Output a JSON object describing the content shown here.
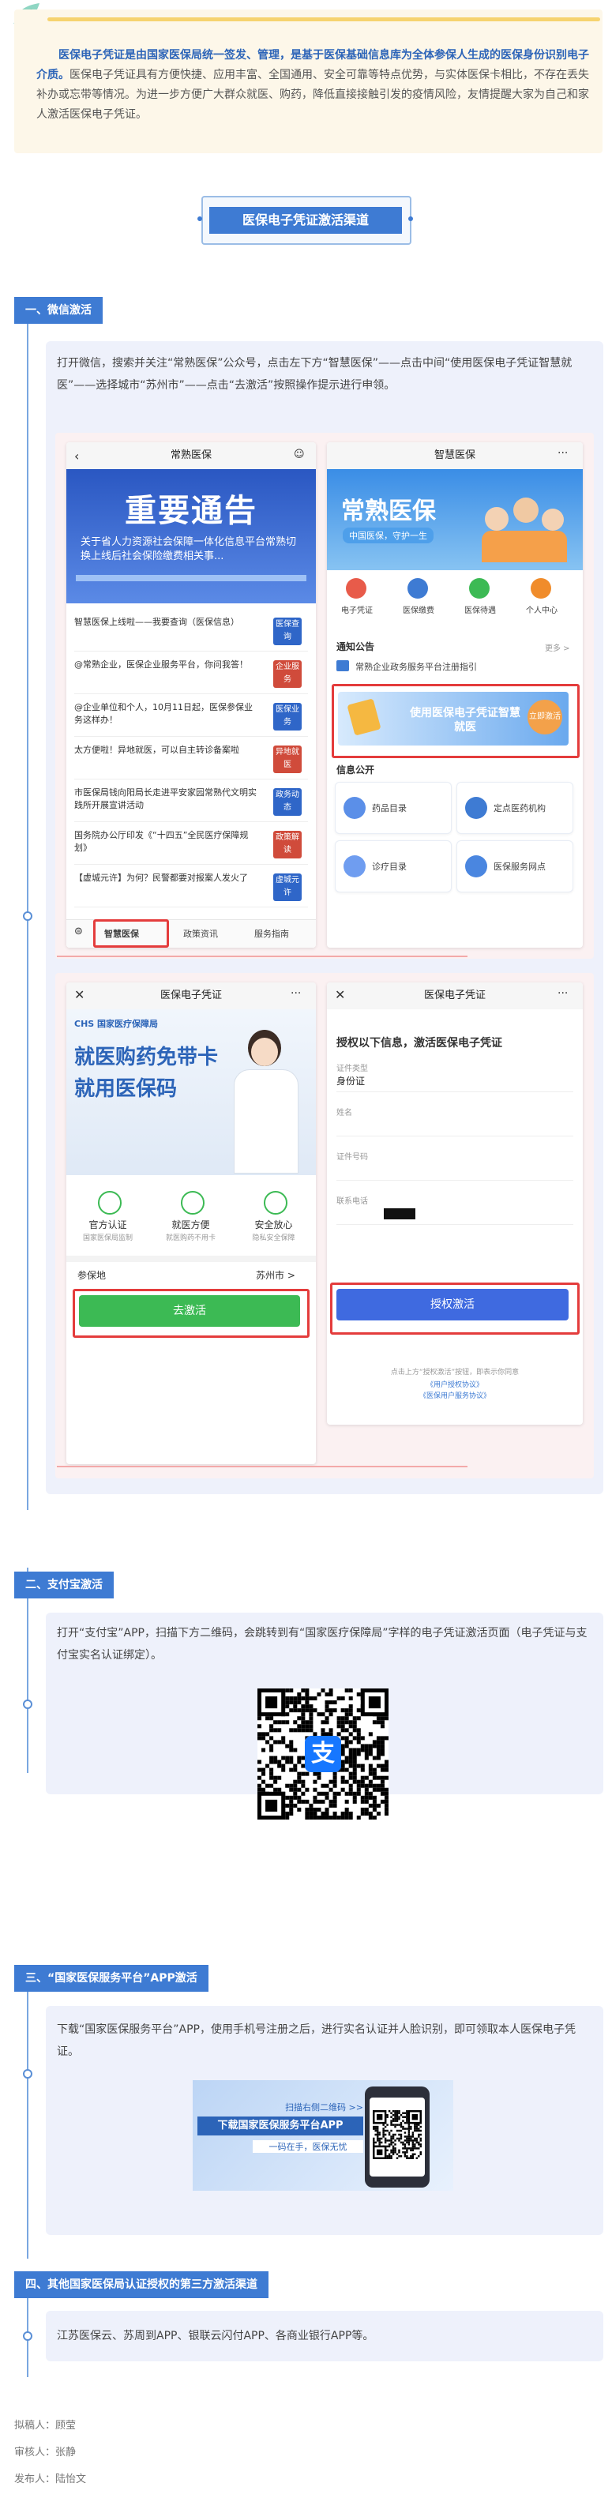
{
  "intro": {
    "highlight": "医保电子凭证是由国家医保局统一签发、管理，是基于医保基础信息库为全体参保人生成的医保身份识别电子介质。",
    "body": "医保电子凭证具有方便快捷、应用丰富、全国通用、安全可靠等特点优势，与实体医保卡相比，不存在丢失补办或忘带等情况。为进一步方便广大群众就医、购药，降低直接接触引发的疫情风险，友情提醒大家为自己和家人激活医保电子凭证。"
  },
  "banner": {
    "title": "医保电子凭证激活渠道"
  },
  "sections": [
    {
      "heading": "一、微信激活",
      "text": "打开微信，搜索并关注“常熟医保”公众号，点击左下方“智慧医保”——点击中间“使用医保电子凭证智慧就医”——选择城市“苏州市”——点击“去激活”按照操作提示进行申领。"
    },
    {
      "heading": "二、支付宝激活",
      "text": "打开“支付宝”APP，扫描下方二维码，会跳转到有“国家医疗保障局”字样的电子凭证激活页面（电子凭证与支付宝实名认证绑定）。"
    },
    {
      "heading": "三、“国家医保服务平台”APP激活",
      "text": "下载“国家医保服务平台”APP，使用手机号注册之后，进行实名认证并人脸识别，即可领取本人医保电子凭证。"
    },
    {
      "heading": "四、其他国家医保局认证授权的第三方激活渠道",
      "text": "江苏医保云、苏周到APP、银联云闪付APP、各商业银行APP等。"
    }
  ],
  "phone1": {
    "title": "常熟医保",
    "notice_title": "重要通告",
    "notice_sub": "关于省人力资源社会保障一体化信息平台常熟切换上线后社会保险缴费相关事...",
    "items": [
      {
        "text": "智慧医保上线啦——我要查询（医保信息）",
        "tag": "医保查询"
      },
      {
        "text": "@常熟企业，医保企业服务平台，你问我答！",
        "tag": "企业服务"
      },
      {
        "text": "@企业单位和个人，10月11日起，医保参保业务这样办！",
        "tag": "医保业务"
      },
      {
        "text": "太方便啦！异地就医，可以自主转诊备案啦",
        "tag": "异地就医"
      },
      {
        "text": "市医保局钱向阳局长走进平安家园常熟代文明实践所开展宣讲活动",
        "tag": "政务动态"
      },
      {
        "text": "国务院办公厅印发《“十四五”全民医疗保障规划》",
        "tag": "政策解读"
      },
      {
        "text": "【虚城元许】为何？民警都要对报案人发火了",
        "tag": "虚城元许"
      }
    ],
    "tabs": [
      "智慧医保",
      "政策资讯",
      "服务指南"
    ]
  },
  "phone2": {
    "title": "智慧医保",
    "brand": "常熟医保",
    "slogan": "中国医保，守护一生",
    "icons": [
      "电子凭证",
      "医保缴费",
      "医保待遇",
      "个人中心"
    ],
    "notice_label": "通知公告",
    "more": "更多 >",
    "notice_item": "常熟企业政务服务平台注册指引",
    "use_card": "使用医保电子凭证智慧就医",
    "use_btn": "立即激活",
    "info_label": "信息公开",
    "grid": [
      "药品目录",
      "定点医药机构",
      "诊疗目录",
      "医保服务网点"
    ]
  },
  "phone3": {
    "title": "医保电子凭证",
    "logo": "CHS 国家医疗保障局",
    "promo1": "就医购药免带卡",
    "promo2": "就用医保码",
    "features": [
      {
        "name": "官方认证",
        "sub": "国家医保局监制"
      },
      {
        "name": "就医方便",
        "sub": "就医购药不用卡"
      },
      {
        "name": "安全放心",
        "sub": "隐私安全保障"
      }
    ],
    "place_label": "参保地",
    "place_value": "苏州市 >",
    "button": "去激活"
  },
  "phone4": {
    "title": "医保电子凭证",
    "heading": "授权以下信息，激活医保电子凭证",
    "fields": [
      {
        "label": "证件类型",
        "value": "身份证"
      },
      {
        "label": "姓名",
        "value": ""
      },
      {
        "label": "证件号码",
        "value": ""
      },
      {
        "label": "联系电话",
        "value": ""
      }
    ],
    "button": "授权激活",
    "agree": "点击上方“授权激活”按钮，即表示你同意",
    "link1": "《用户授权协议》",
    "link2": "《医保用户服务协议》"
  },
  "app_banner": {
    "line1": "扫描右侧二维码 >>",
    "line2": "下载国家医保服务平台APP",
    "line3": "一码在手，医保无忧"
  },
  "footer": {
    "author": "拟稿人：顾莹",
    "reviewer": "审核人：张静",
    "publisher": "发布人：陆怡文"
  },
  "colors": {
    "accent": "#3e7bd3",
    "red": "#e43c3c",
    "green": "#3cba54",
    "cream": "#fdf7e9"
  }
}
